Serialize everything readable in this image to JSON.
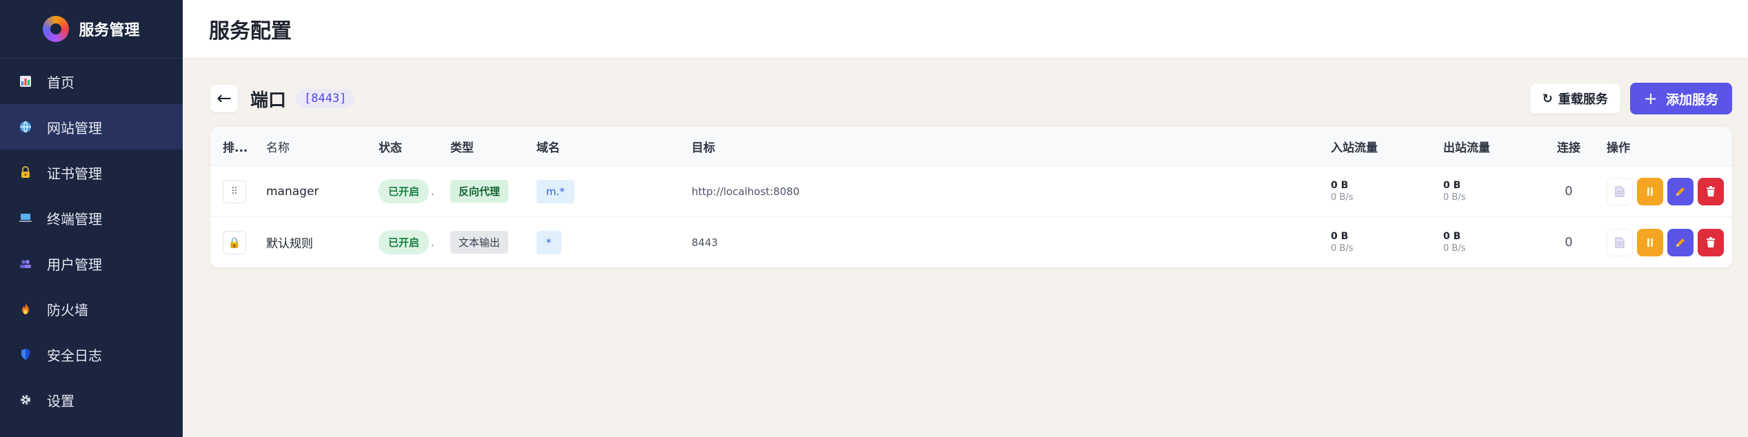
{
  "brand": {
    "title": "服务管理"
  },
  "sidebar": {
    "items": [
      {
        "label": "首页",
        "icon": "chart-icon",
        "active": false
      },
      {
        "label": "网站管理",
        "icon": "globe-icon",
        "active": true
      },
      {
        "label": "证书管理",
        "icon": "lock-icon",
        "active": false
      },
      {
        "label": "终端管理",
        "icon": "laptop-icon",
        "active": false
      },
      {
        "label": "用户管理",
        "icon": "users-icon",
        "active": false
      },
      {
        "label": "防火墙",
        "icon": "fire-icon",
        "active": false
      },
      {
        "label": "安全日志",
        "icon": "shield-icon",
        "active": false
      },
      {
        "label": "设置",
        "icon": "gear-icon",
        "active": false
      }
    ]
  },
  "header": {
    "title": "服务配置"
  },
  "toolbar": {
    "back": "←",
    "title": "端口",
    "port_badge": "[8443]",
    "reload_label": "重载服务",
    "add_label": "添加服务"
  },
  "table": {
    "headers": [
      "排...",
      "名称",
      "状态",
      "类型",
      "域名",
      "目标",
      "入站流量",
      "出站流量",
      "连接",
      "操作"
    ],
    "rows": [
      {
        "sort": "drag-handle",
        "name": "manager",
        "status": "已开启",
        "type": "反向代理",
        "domain": "m.*",
        "target": "http://localhost:8080",
        "in_total": "0 B",
        "in_rate": "0 B/s",
        "out_total": "0 B",
        "out_rate": "0 B/s",
        "connections": "0"
      },
      {
        "sort": "lock",
        "name": "默认规则",
        "status": "已开启",
        "type": "文本输出",
        "domain": "*",
        "target": "8443",
        "in_total": "0 B",
        "in_rate": "0 B/s",
        "out_total": "0 B",
        "out_rate": "0 B/s",
        "connections": "0"
      }
    ]
  },
  "colors": {
    "sidebar_bg": "#1b2540",
    "accent": "#5a55e6",
    "pause": "#f5a524",
    "delete": "#e02d3c",
    "status_on": "#15803d"
  }
}
